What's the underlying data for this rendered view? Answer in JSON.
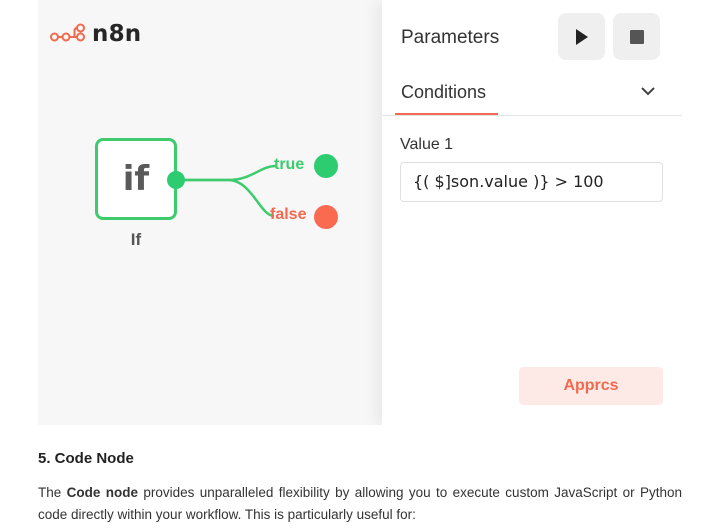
{
  "app": {
    "logo_text": "n8n"
  },
  "canvas": {
    "if_node": {
      "glyph": "if",
      "label": "If"
    },
    "outputs": {
      "true_label": "true",
      "false_label": "false"
    }
  },
  "colors": {
    "accent": "#f06a4f",
    "node_green": "#3ecb6e",
    "false_red": "#fa6a51"
  },
  "panel": {
    "title": "Parameters",
    "play_icon": "play-icon",
    "stop_icon": "stop-icon",
    "tab": "Conditions",
    "field_label": "Value 1",
    "field_value": "{( $]son.value )} > 100",
    "apply_label": "Apprcs"
  },
  "article": {
    "heading": "5. Code Node",
    "para_start": "The ",
    "para_bold": "Code node",
    "para_rest": " provides unparalleled flexibility by allowing you to execute custom JavaScript or Python code directly within your workflow. This is particularly useful for:"
  }
}
